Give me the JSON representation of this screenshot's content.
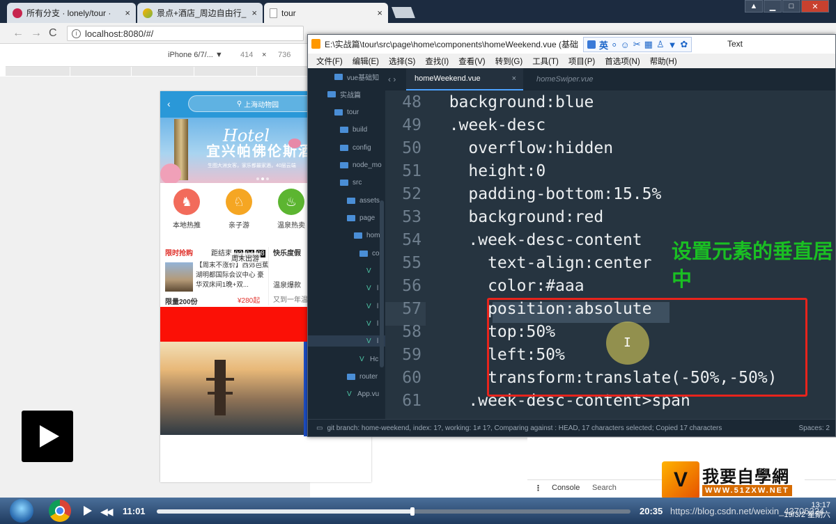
{
  "browser": {
    "tabs": [
      {
        "title": "所有分支 · lonely/tour ·",
        "close": "×"
      },
      {
        "title": "景点+酒店_周边自由行_",
        "close": "×"
      },
      {
        "title": "tour",
        "close": "×"
      }
    ],
    "window_controls": [
      "▲",
      "▁",
      "□",
      "✕"
    ],
    "nav": {
      "back": "←",
      "forward": "→",
      "reload": "C"
    },
    "url": "localhost:8080/#/"
  },
  "device_toolbar": {
    "device": "iPhone 6/7/... ▼",
    "width": "414",
    "times": "×",
    "height": "736"
  },
  "phone": {
    "back_arrow": "‹",
    "search_placeholder": "上海动物园",
    "search_icon_glyph": "⚲",
    "banner": {
      "script": "Hotel",
      "title": "宜兴帕佛伦斯酒",
      "subtitle": "生图大洲女客，家乐都最家酒，40层云端"
    },
    "icons": [
      {
        "label": "本地热推",
        "color": "#f26b5b"
      },
      {
        "label": "亲子游",
        "color": "#f5a623"
      },
      {
        "label": "温泉热卖",
        "color": "#5cb531"
      }
    ],
    "rec": {
      "limit_label": "限时抢购",
      "countdown_prefix": "距结束",
      "cd_h": "02",
      "cd_m": "04",
      "cd_s": "08",
      "desc": "【周末不涨价】西郊芭蕉 湖明都国际会议中心 豪华双床间1晚+双...",
      "price": "¥280起",
      "limit_qty": "限量200份",
      "right_title": "快乐度假",
      "right_hot": "温泉爆款",
      "right_sub": "又到一年温泉季",
      "overlay": "周末出游"
    }
  },
  "editor": {
    "title": "E:\\实战篇\\tour\\src\\page\\home\\components\\homeWeekend.vue (基础",
    "ime_lang": "英",
    "ime_extra": "Text",
    "menu": [
      "文件(F)",
      "编辑(E)",
      "选择(S)",
      "查找(I)",
      "查看(V)",
      "转到(G)",
      "工具(T)",
      "项目(P)",
      "首选项(N)",
      "帮助(H)"
    ],
    "sidebar": [
      {
        "label": "vue基础知",
        "type": "folder"
      },
      {
        "label": "实战篇",
        "type": "folder"
      },
      {
        "label": "tour",
        "type": "folder"
      },
      {
        "label": "build",
        "type": "folder"
      },
      {
        "label": "config",
        "type": "folder"
      },
      {
        "label": "node_mo",
        "type": "folder"
      },
      {
        "label": "src",
        "type": "folder"
      },
      {
        "label": "assets",
        "type": "folder"
      },
      {
        "label": "page",
        "type": "folder"
      },
      {
        "label": "hom",
        "type": "folder"
      },
      {
        "label": "co",
        "type": "folder"
      },
      {
        "label": "",
        "type": "vue"
      },
      {
        "label": "l",
        "type": "vue"
      },
      {
        "label": "l",
        "type": "vue"
      },
      {
        "label": "l",
        "type": "vue"
      },
      {
        "label": "l",
        "type": "vue"
      },
      {
        "label": "Hc",
        "type": "vue"
      },
      {
        "label": "router",
        "type": "folder"
      },
      {
        "label": "App.vu",
        "type": "vue"
      }
    ],
    "tab_arrows": "‹ ›",
    "tabs": [
      {
        "label": "homeWeekend.vue",
        "close": "×"
      },
      {
        "label": "homeSwiper.vue"
      }
    ],
    "lines": [
      {
        "num": "48",
        "text": "  background:blue"
      },
      {
        "num": "49",
        "text": "  .week-desc"
      },
      {
        "num": "50",
        "text": "    overflow:hidden"
      },
      {
        "num": "51",
        "text": "    height:0"
      },
      {
        "num": "52",
        "text": "    padding-bottom:15.5%"
      },
      {
        "num": "53",
        "text": "    background:red"
      },
      {
        "num": "54",
        "text": "    .week-desc-content"
      },
      {
        "num": "55",
        "text": "      text-align:center"
      },
      {
        "num": "56",
        "text": "      color:#aaa"
      },
      {
        "num": "57",
        "text": "      position:absolute"
      },
      {
        "num": "58",
        "text": "      top:50%"
      },
      {
        "num": "59",
        "text": "      left:50%"
      },
      {
        "num": "60",
        "text": "      transform:translate(-50%,-50%)"
      },
      {
        "num": "61",
        "text": "    .week-desc-content>span"
      }
    ],
    "annotation": "设置元素的垂直居中",
    "cursor": "I",
    "status": "git branch: home-weekend, index: 1?, working: 1≠ 1?, Comparing against : HEAD, 17 characters selected; Copied 17 characters",
    "spaces": "Spaces: 2"
  },
  "devtools": {
    "console": "Console",
    "search": "Search",
    "menu": "⋮"
  },
  "watermark": {
    "logo": "V",
    "name": "我要自學網",
    "site": "WWW.51ZXW.NET"
  },
  "player": {
    "time": "11:01",
    "duration": "20:35",
    "progress": 0.54,
    "overlay_url": "https://blog.csdn.net/weixin_43706224",
    "clock_time": "13:17",
    "clock_date": "19/3/2 星期六"
  }
}
